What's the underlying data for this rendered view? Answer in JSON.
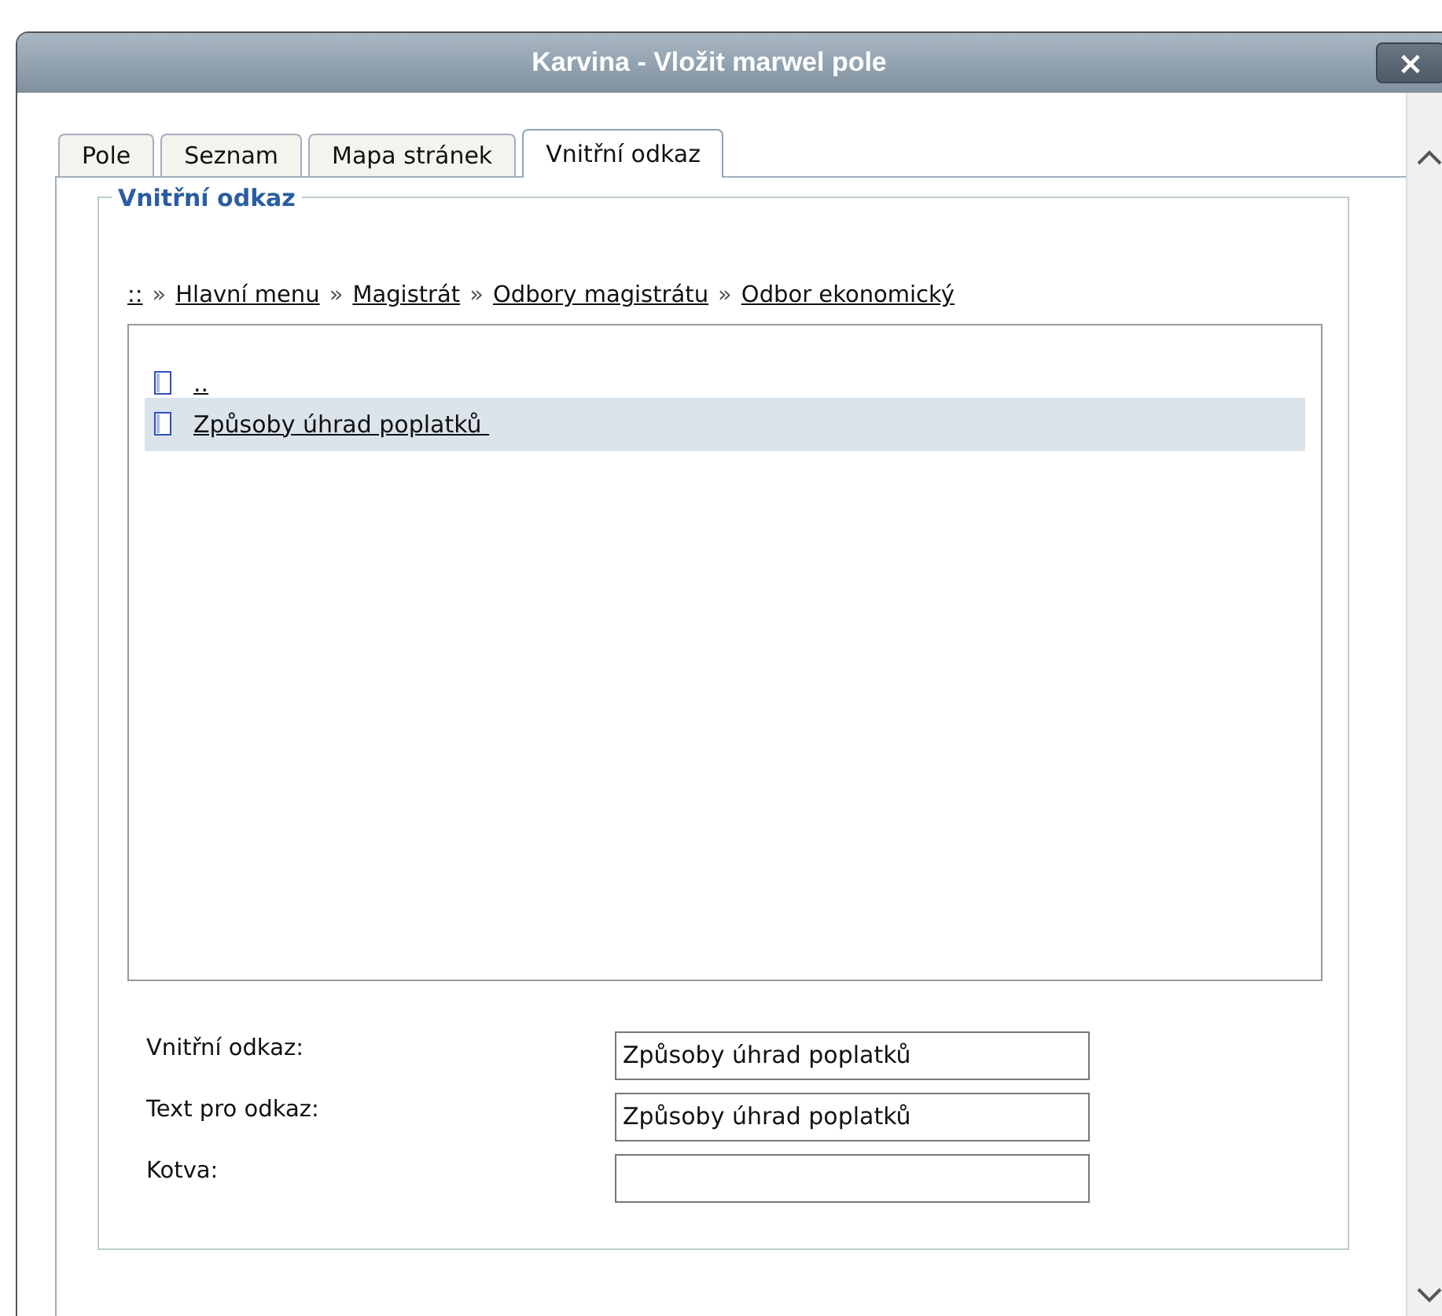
{
  "window": {
    "title": "Karvina - Vložit marwel pole",
    "close": "×"
  },
  "tabs": [
    {
      "label": "Pole",
      "selected": false
    },
    {
      "label": "Seznam",
      "selected": false
    },
    {
      "label": "Mapa stránek",
      "selected": false
    },
    {
      "label": "Vnitřní odkaz",
      "selected": true
    }
  ],
  "section": {
    "legend": "Vnitřní odkaz"
  },
  "breadcrumb": {
    "separator": "»",
    "items": [
      "::",
      "Hlavní menu",
      "Magistrát",
      "Odbory magistrátu",
      "Odbor ekonomický"
    ]
  },
  "pages": [
    {
      "label": "..",
      "selected": false
    },
    {
      "label": "Způsoby úhrad poplatků ",
      "selected": true
    }
  ],
  "fields": [
    {
      "label": "Vnitřní odkaz:",
      "value": "Způsoby úhrad poplatků"
    },
    {
      "label": "Text pro odkaz:",
      "value": "Způsoby úhrad poplatků"
    },
    {
      "label": "Kotva:"
    }
  ]
}
